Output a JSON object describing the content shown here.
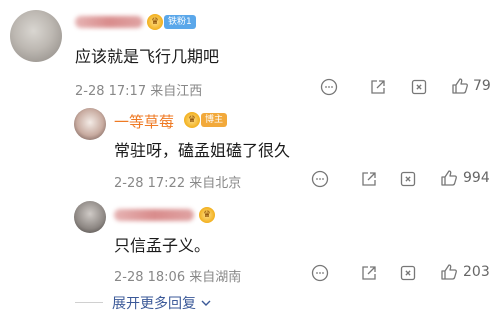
{
  "comments": [
    {
      "name": "",
      "fan_tag": "铁粉1",
      "content": "应该就是飞行几期吧",
      "time": "2-28 17:17",
      "location": "来自江西",
      "likes": "79"
    },
    {
      "name": "一等草莓",
      "host_tag": "博主",
      "content": "常驻呀，磕孟姐磕了很久",
      "time": "2-28 17:22",
      "location": "来自北京",
      "likes": "994"
    },
    {
      "name": "",
      "content": "只信孟子义。",
      "time": "2-28 18:06",
      "location": "来自湖南",
      "likes": "203"
    }
  ],
  "expand_label": "展开更多回复",
  "colors": {
    "accent": "#ef7a24",
    "link": "#3b5998",
    "meta": "#888888"
  },
  "icons": [
    "comment-icon",
    "share-icon",
    "repost-icon",
    "like-icon",
    "chevron-down-icon"
  ]
}
